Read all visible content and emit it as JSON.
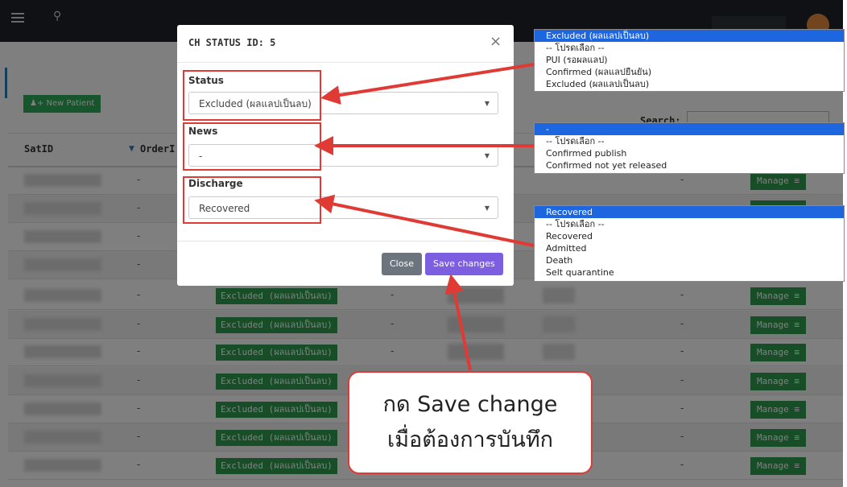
{
  "topbar": {
    "menu_icon": "hamburger-icon",
    "search_icon": "search-icon"
  },
  "toolbar": {
    "new_patient_label": "New Patient",
    "search_label": "Search:"
  },
  "table": {
    "columns": [
      "SatID",
      "OrderI"
    ],
    "status_badge": "Excluded (ผลแลปเป็นลบ)",
    "dash": "-",
    "manage_label": "Manage ≡",
    "manage_rows": 7
  },
  "modal": {
    "title": "CH STATUS ID: 5",
    "close_icon": "×",
    "status_label": "Status",
    "status_value": "Excluded (ผลแลปเป็นลบ)",
    "news_label": "News",
    "news_value": "-",
    "discharge_label": "Discharge",
    "discharge_value": "Recovered",
    "close_button": "Close",
    "save_button": "Save changes"
  },
  "status_options": [
    "Excluded (ผลแลปเป็นลบ)",
    "-- โปรดเลือก --",
    "PUI (รอผลแลป)",
    "Confirmed (ผลแลปยืนยัน)",
    "Excluded (ผลแลปเป็นลบ)"
  ],
  "news_options": [
    "-",
    "-- โปรดเลือก --",
    "Confirmed publish",
    "Confirmed not yet released"
  ],
  "discharge_options": [
    "Recovered",
    "-- โปรดเลือก --",
    "Recovered",
    "Admitted",
    "Death",
    "Selt quarantine"
  ],
  "callout": {
    "line1": "กด Save change",
    "line2": "เมื่อต้องการบันทึก"
  },
  "colors": {
    "accent": "#7b5fe0",
    "highlight": "#e03a35",
    "badge": "#2e9c51",
    "selection": "#1e66e0"
  }
}
